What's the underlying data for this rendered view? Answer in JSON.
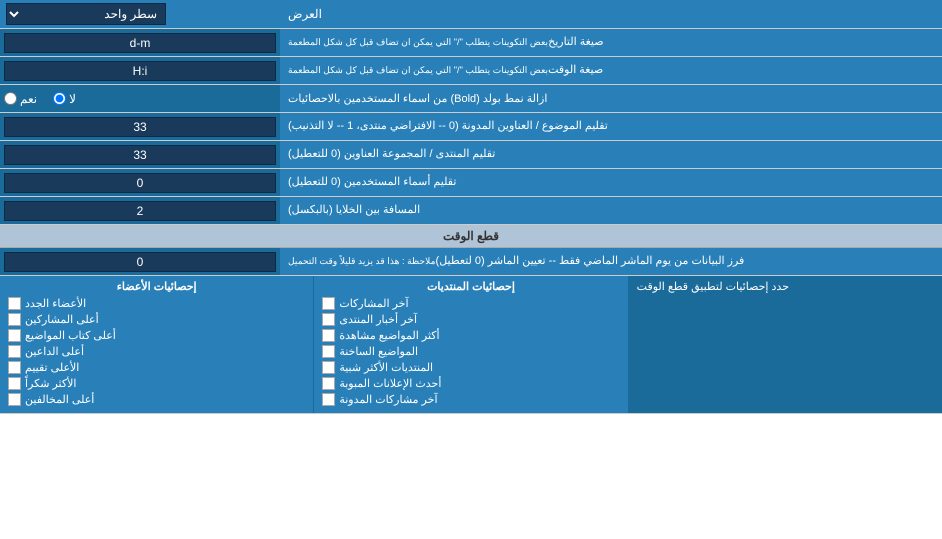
{
  "header": {
    "display_label": "العرض",
    "display_value": "سطر واحد"
  },
  "rows": [
    {
      "id": "date_format",
      "label": "صيغة التاريخ",
      "sublabel": "بعض التكوينات يتطلب \"/\" التي يمكن ان تضاف قبل كل شكل المطعمة",
      "value": "d-m"
    },
    {
      "id": "time_format",
      "label": "صيغة الوقت",
      "sublabel": "بعض التكوينات يتطلب \"/\" التي يمكن ان تضاف قبل كل شكل المطعمة",
      "value": "H:i"
    },
    {
      "id": "bold_remove",
      "label": "ازالة نمط بولد (Bold) من اسماء المستخدمين بالاحصائيات",
      "radio_yes": "نعم",
      "radio_no": "لا",
      "selected": "no"
    },
    {
      "id": "topic_count",
      "label": "تقليم الموضوع / العناوين المدونة (0 -- الافتراضي منتدى، 1 -- لا التذنيب)",
      "value": "33"
    },
    {
      "id": "forum_group",
      "label": "تقليم المنتدى / المجموعة العناوين (0 للتعطيل)",
      "value": "33"
    },
    {
      "id": "username_trim",
      "label": "تقليم أسماء المستخدمين (0 للتعطيل)",
      "value": "0"
    },
    {
      "id": "cell_spacing",
      "label": "المسافة بين الخلايا (بالبكسل)",
      "value": "2"
    }
  ],
  "time_section": {
    "header": "قطع الوقت",
    "cutoff_label": "فرز البيانات من يوم الماشر الماضي فقط -- تعيين الماشر (0 لتعطيل)",
    "cutoff_note": "ملاحظة : هذا قد يزيد قليلاً وقت التحميل",
    "cutoff_value": "0"
  },
  "stats_section": {
    "limit_label": "حدد إحصائيات لتطبيق قطع الوقت",
    "col1": {
      "title": "",
      "items": []
    },
    "col2_title": "إحصائيات المنتديات",
    "col2_items": [
      {
        "label": "آخر المشاركات",
        "checked": false
      },
      {
        "label": "آخر أخبار المنتدى",
        "checked": false
      },
      {
        "label": "أكثر المواضيع مشاهدة",
        "checked": false
      },
      {
        "label": "المواضيع الساخنة",
        "checked": false
      },
      {
        "label": "المنتديات الأكثر شبية",
        "checked": false
      },
      {
        "label": "أحدث الإعلانات المبوبة",
        "checked": false
      },
      {
        "label": "آخر مشاركات المدونة",
        "checked": false
      }
    ],
    "col3_title": "إحصائيات الأعضاء",
    "col3_items": [
      {
        "label": "الأعضاء الجدد",
        "checked": false
      },
      {
        "label": "أعلى المشاركين",
        "checked": false
      },
      {
        "label": "أعلى كتاب المواضيع",
        "checked": false
      },
      {
        "label": "أعلى الداعين",
        "checked": false
      },
      {
        "label": "الأعلى تقييم",
        "checked": false
      },
      {
        "label": "الأكثر شكراً",
        "checked": false
      },
      {
        "label": "أعلى المخالفين",
        "checked": false
      }
    ]
  }
}
